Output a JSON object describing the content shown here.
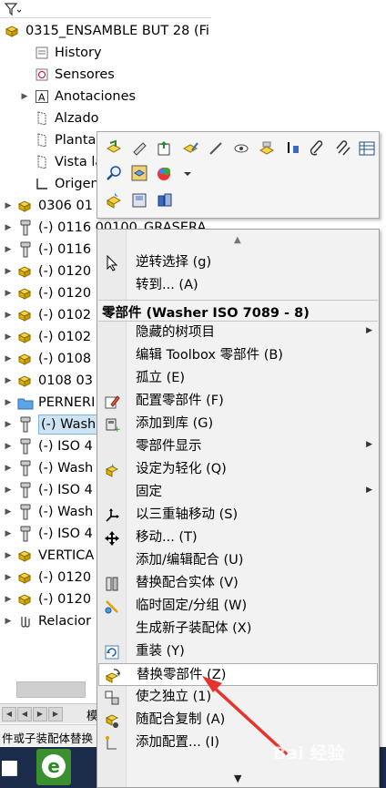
{
  "tree": {
    "filter_icon": "filter-icon",
    "items": [
      {
        "label": "0315_ENSAMBLE BUT 28  (Fi",
        "icon": "assembly-icon"
      },
      {
        "label": "History",
        "icon": "history-icon"
      },
      {
        "label": "Sensores",
        "icon": "sensor-icon"
      },
      {
        "label": "Anotaciones",
        "icon": "annotation-icon"
      },
      {
        "label": "Alzado",
        "icon": "plane-icon"
      },
      {
        "label": "Planta",
        "icon": "plane-icon"
      },
      {
        "label": "Vista late",
        "icon": "plane-icon"
      },
      {
        "label": "Origen",
        "icon": "origin-icon"
      },
      {
        "label": "0306 01",
        "icon": "assembly-icon"
      },
      {
        "label": "(-) 0116 00100_GRASERA",
        "icon": "bolt-icon"
      },
      {
        "label": "(-) 0116",
        "icon": "bolt-icon"
      },
      {
        "label": "(-) 0120",
        "icon": "assembly-icon"
      },
      {
        "label": "(-) 0120",
        "icon": "assembly-icon"
      },
      {
        "label": "(-) 0102",
        "icon": "assembly-icon"
      },
      {
        "label": "(-) 0102",
        "icon": "assembly-icon"
      },
      {
        "label": "(-) 0108",
        "icon": "assembly-icon"
      },
      {
        "label": "0108 03",
        "icon": "assembly-icon"
      },
      {
        "label": "PERNERI",
        "icon": "folder-icon"
      },
      {
        "label": "(-) Wash",
        "icon": "bolt-icon"
      },
      {
        "label": "(-) ISO 4",
        "icon": "bolt-icon"
      },
      {
        "label": "(-) Wash",
        "icon": "bolt-icon"
      },
      {
        "label": "(-) ISO 4",
        "icon": "bolt-icon"
      },
      {
        "label": "(-) Wash",
        "icon": "bolt-icon"
      },
      {
        "label": "(-) ISO 4",
        "icon": "bolt-icon"
      },
      {
        "label": "VERTICA",
        "icon": "assembly-icon"
      },
      {
        "label": "(-) 0120",
        "icon": "assembly-icon"
      },
      {
        "label": "(-) 0120",
        "icon": "assembly-icon"
      },
      {
        "label": "Relacior",
        "icon": "mates-icon"
      }
    ],
    "selected_index": 18
  },
  "bottom": {
    "tab_label": "模",
    "status_text": "件或子装配体替换"
  },
  "taskbar": {
    "start_glyph": "■",
    "ie_glyph": "e"
  },
  "toolbar": {
    "buttons": [
      "open-part-icon",
      "edit-part-icon",
      "insert-component-icon",
      "component-properties-icon",
      "pin-icon",
      "view-icon",
      "hide-show-icon",
      "move-icon",
      "paperclip-icon",
      "attach-icon",
      "table-icon",
      "zoom-icon",
      "isolate-icon",
      "appearance-icon",
      "dropdown-icon",
      "lightweight-icon",
      "save-icon",
      "components-icon"
    ]
  },
  "menu": {
    "items_top": [
      {
        "label": "逆转选择 (g)",
        "icon": "cursor-icon"
      },
      {
        "label": "转到... (A)",
        "icon": ""
      }
    ],
    "header": "零部件 (Washer ISO 7089 - 8)",
    "items": [
      {
        "label": "隐藏的树项目",
        "icon": "",
        "submenu": true
      },
      {
        "label": "编辑 Toolbox 零部件 (B)",
        "icon": ""
      },
      {
        "label": "孤立 (E)",
        "icon": ""
      },
      {
        "label": "配置零部件 (F)",
        "icon": "configure-icon"
      },
      {
        "label": "添加到库 (G)",
        "icon": "add-library-icon"
      },
      {
        "label": "零部件显示",
        "icon": "",
        "submenu": true
      },
      {
        "label": "设定为轻化 (Q)",
        "icon": "lightweight-icon"
      },
      {
        "label": "固定",
        "icon": "",
        "submenu": true
      },
      {
        "label": "以三重轴移动 (S)",
        "icon": "triad-icon"
      },
      {
        "label": "移动... (T)",
        "icon": "move-arrows-icon"
      },
      {
        "label": "添加/编辑配合 (U)",
        "icon": ""
      },
      {
        "label": "替换配合实体 (V)",
        "icon": "replace-mate-icon"
      },
      {
        "label": "临时固定/分组 (W)",
        "icon": "temp-fix-icon"
      },
      {
        "label": "生成新子装配体 (X)",
        "icon": ""
      },
      {
        "label": "重装 (Y)",
        "icon": "reload-icon"
      },
      {
        "label": "替换零部件 (Z)",
        "icon": "replace-component-icon"
      },
      {
        "label": "使之独立 (1)",
        "icon": "independent-icon"
      },
      {
        "label": "随配合复制 (A)",
        "icon": "copy-mates-icon"
      },
      {
        "label": "添加配置... (I)",
        "icon": "add-config-icon"
      }
    ],
    "highlighted_label": "替换零部件 (Z)"
  },
  "colors": {
    "annotation_arrow": "#e8332c",
    "selection_fill": "#cde4f7",
    "assembly_yellow": "#f2c200",
    "taskbar": "#1a2c4a"
  },
  "watermark": "Bai 经验"
}
